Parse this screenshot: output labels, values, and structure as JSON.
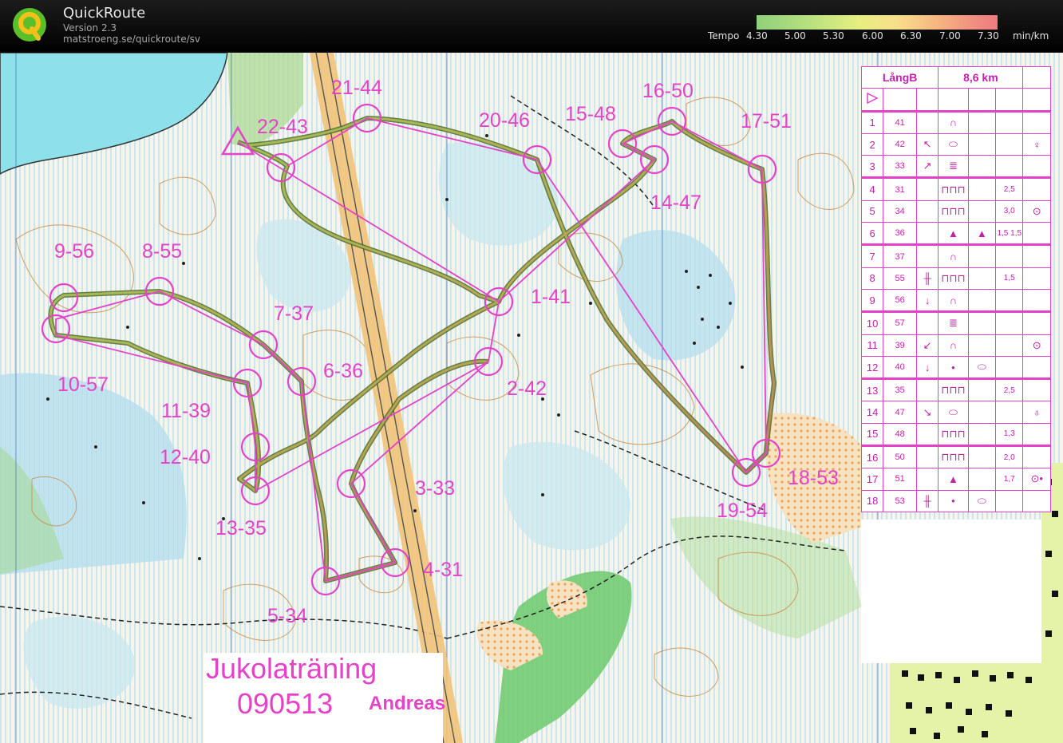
{
  "app": {
    "title": "QuickRoute",
    "version": "Version 2.3",
    "url": "matstroeng.se/quickroute/sv"
  },
  "tempo_scale": {
    "label": "Tempo",
    "ticks": [
      "4.30",
      "5.00",
      "5.30",
      "6.00",
      "6.30",
      "7.00",
      "7.30"
    ],
    "unit": "min/km",
    "colors": [
      "#8fd07a",
      "#e6ef80",
      "#f6b680",
      "#ee7a80"
    ]
  },
  "map": {
    "title_line1": "Jukolaträning",
    "title_line2": "090513",
    "runner": "Andreas",
    "course_color": "#e443c9",
    "controls": [
      {
        "label": "1-41"
      },
      {
        "label": "2-42"
      },
      {
        "label": "3-33"
      },
      {
        "label": "4-31"
      },
      {
        "label": "5-34"
      },
      {
        "label": "6-36"
      },
      {
        "label": "7-37"
      },
      {
        "label": "8-55"
      },
      {
        "label": "9-56"
      },
      {
        "label": "10-57"
      },
      {
        "label": "11-39"
      },
      {
        "label": "12-40"
      },
      {
        "label": "13-35"
      },
      {
        "label": "14-47"
      },
      {
        "label": "15-48"
      },
      {
        "label": "16-50"
      },
      {
        "label": "17-51"
      },
      {
        "label": "18-53"
      },
      {
        "label": "19-54"
      },
      {
        "label": "20-46"
      },
      {
        "label": "21-44"
      },
      {
        "label": "22-43"
      }
    ]
  },
  "description_sheet": {
    "course_name": "LångB",
    "length": "8,6 km",
    "rows": [
      {
        "num": "1",
        "code": "41",
        "dir": "",
        "feature": "∩",
        "dim": "",
        "loc": ""
      },
      {
        "num": "2",
        "code": "42",
        "dir": "↖",
        "feature": "⬭",
        "dim": "",
        "loc": "♀"
      },
      {
        "num": "3",
        "code": "33",
        "dir": "↗",
        "feature": "≣",
        "dim": "",
        "loc": ""
      },
      {
        "num": "4",
        "code": "31",
        "dir": "",
        "feature": "⊓⊓⊓",
        "dim": "2,5",
        "loc": ""
      },
      {
        "num": "5",
        "code": "34",
        "dir": "",
        "feature": "⊓⊓⊓",
        "dim": "3,0",
        "loc": "⊙"
      },
      {
        "num": "6",
        "code": "36",
        "dir": "",
        "feature": "▲",
        "detail": "▲",
        "dim": "1,5 1,5",
        "loc": ""
      },
      {
        "num": "7",
        "code": "37",
        "dir": "",
        "feature": "∩",
        "dim": "",
        "loc": ""
      },
      {
        "num": "8",
        "code": "55",
        "dir": "╫",
        "feature": "⊓⊓⊓",
        "dim": "1,5",
        "loc": ""
      },
      {
        "num": "9",
        "code": "56",
        "dir": "↓",
        "feature": "∩",
        "dim": "",
        "loc": ""
      },
      {
        "num": "10",
        "code": "57",
        "dir": "",
        "feature": "≣",
        "dim": "",
        "loc": ""
      },
      {
        "num": "11",
        "code": "39",
        "dir": "↙",
        "feature": "∩",
        "dim": "",
        "loc": "⊙"
      },
      {
        "num": "12",
        "code": "40",
        "dir": "↓",
        "feature": "•",
        "detail": "⬭",
        "dim": "",
        "loc": ""
      },
      {
        "num": "13",
        "code": "35",
        "dir": "",
        "feature": "⊓⊓⊓",
        "dim": "2,5",
        "loc": ""
      },
      {
        "num": "14",
        "code": "47",
        "dir": "↘",
        "feature": "⬭",
        "dim": "",
        "loc": "♁"
      },
      {
        "num": "15",
        "code": "48",
        "dir": "",
        "feature": "⊓⊓⊓",
        "dim": "1,3",
        "loc": ""
      },
      {
        "num": "16",
        "code": "50",
        "dir": "",
        "feature": "⊓⊓⊓",
        "dim": "2,0",
        "loc": ""
      },
      {
        "num": "17",
        "code": "51",
        "dir": "",
        "feature": "▲",
        "dim": "1,7",
        "loc": "⊙•"
      },
      {
        "num": "18",
        "code": "53",
        "dir": "╫",
        "feature": "•",
        "detail": "⬭",
        "dim": "",
        "loc": ""
      }
    ]
  }
}
